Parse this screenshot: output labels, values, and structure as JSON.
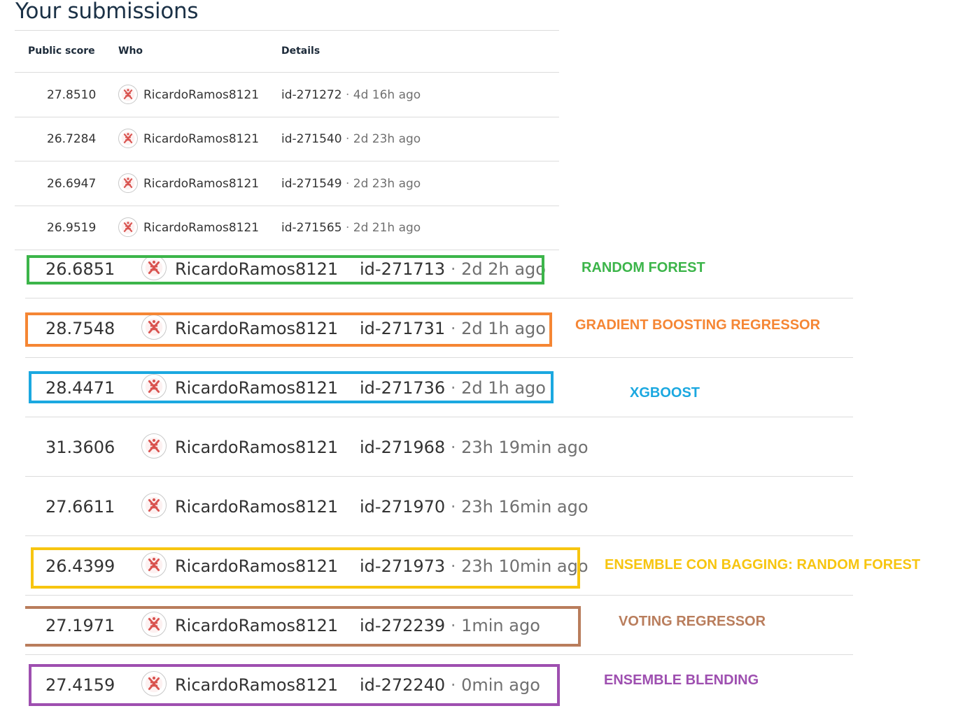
{
  "page": {
    "title": "Your submissions"
  },
  "table": {
    "headers": {
      "score": "Public score",
      "who": "Who",
      "details": "Details"
    },
    "rows": [
      {
        "score": "27.8510",
        "who": "RicardoRamos8121",
        "id": "id-271272",
        "sep": "·",
        "ago": "4d 16h ago"
      },
      {
        "score": "26.7284",
        "who": "RicardoRamos8121",
        "id": "id-271540",
        "sep": "·",
        "ago": "2d 23h ago"
      },
      {
        "score": "26.6947",
        "who": "RicardoRamos8121",
        "id": "id-271549",
        "sep": "·",
        "ago": "2d 23h ago"
      },
      {
        "score": "26.9519",
        "who": "RicardoRamos8121",
        "id": "id-271565",
        "sep": "·",
        "ago": "2d 21h ago"
      },
      {
        "score": "26.6851",
        "who": "RicardoRamos8121",
        "id": "id-271713",
        "sep": "·",
        "ago": "2d 2h ago"
      },
      {
        "score": "28.7548",
        "who": "RicardoRamos8121",
        "id": "id-271731",
        "sep": "·",
        "ago": "2d 1h ago"
      },
      {
        "score": "28.4471",
        "who": "RicardoRamos8121",
        "id": "id-271736",
        "sep": "·",
        "ago": "2d 1h ago"
      },
      {
        "score": "31.3606",
        "who": "RicardoRamos8121",
        "id": "id-271968",
        "sep": "·",
        "ago": "23h 19min ago"
      },
      {
        "score": "27.6611",
        "who": "RicardoRamos8121",
        "id": "id-271970",
        "sep": "·",
        "ago": "23h 16min ago"
      },
      {
        "score": "26.4399",
        "who": "RicardoRamos8121",
        "id": "id-271973",
        "sep": "·",
        "ago": "23h 10min ago"
      },
      {
        "score": "27.1971",
        "who": "RicardoRamos8121",
        "id": "id-272239",
        "sep": "·",
        "ago": "1min ago"
      },
      {
        "score": "27.4159",
        "who": "RicardoRamos8121",
        "id": "id-272240",
        "sep": "·",
        "ago": "0min ago"
      }
    ]
  },
  "annotations": {
    "random_forest": {
      "text": "RANDOM FOREST",
      "color": "#3cb54a"
    },
    "gradient_boosting": {
      "text": "GRADIENT BOOSTING REGRESSOR",
      "color": "#f58634"
    },
    "xgboost": {
      "text": "XGBOOST",
      "color": "#1ba8e0"
    },
    "ensemble_bagging": {
      "text": "ENSEMBLE CON BAGGING: RANDOM FOREST",
      "color": "#f7c510"
    },
    "voting_regressor": {
      "text": "VOTING REGRESSOR",
      "color": "#b97d5c"
    },
    "ensemble_blending": {
      "text": "ENSEMBLE BLENDING",
      "color": "#9e4fb0"
    }
  },
  "icons": {
    "avatar": "user-avatar-icon"
  }
}
